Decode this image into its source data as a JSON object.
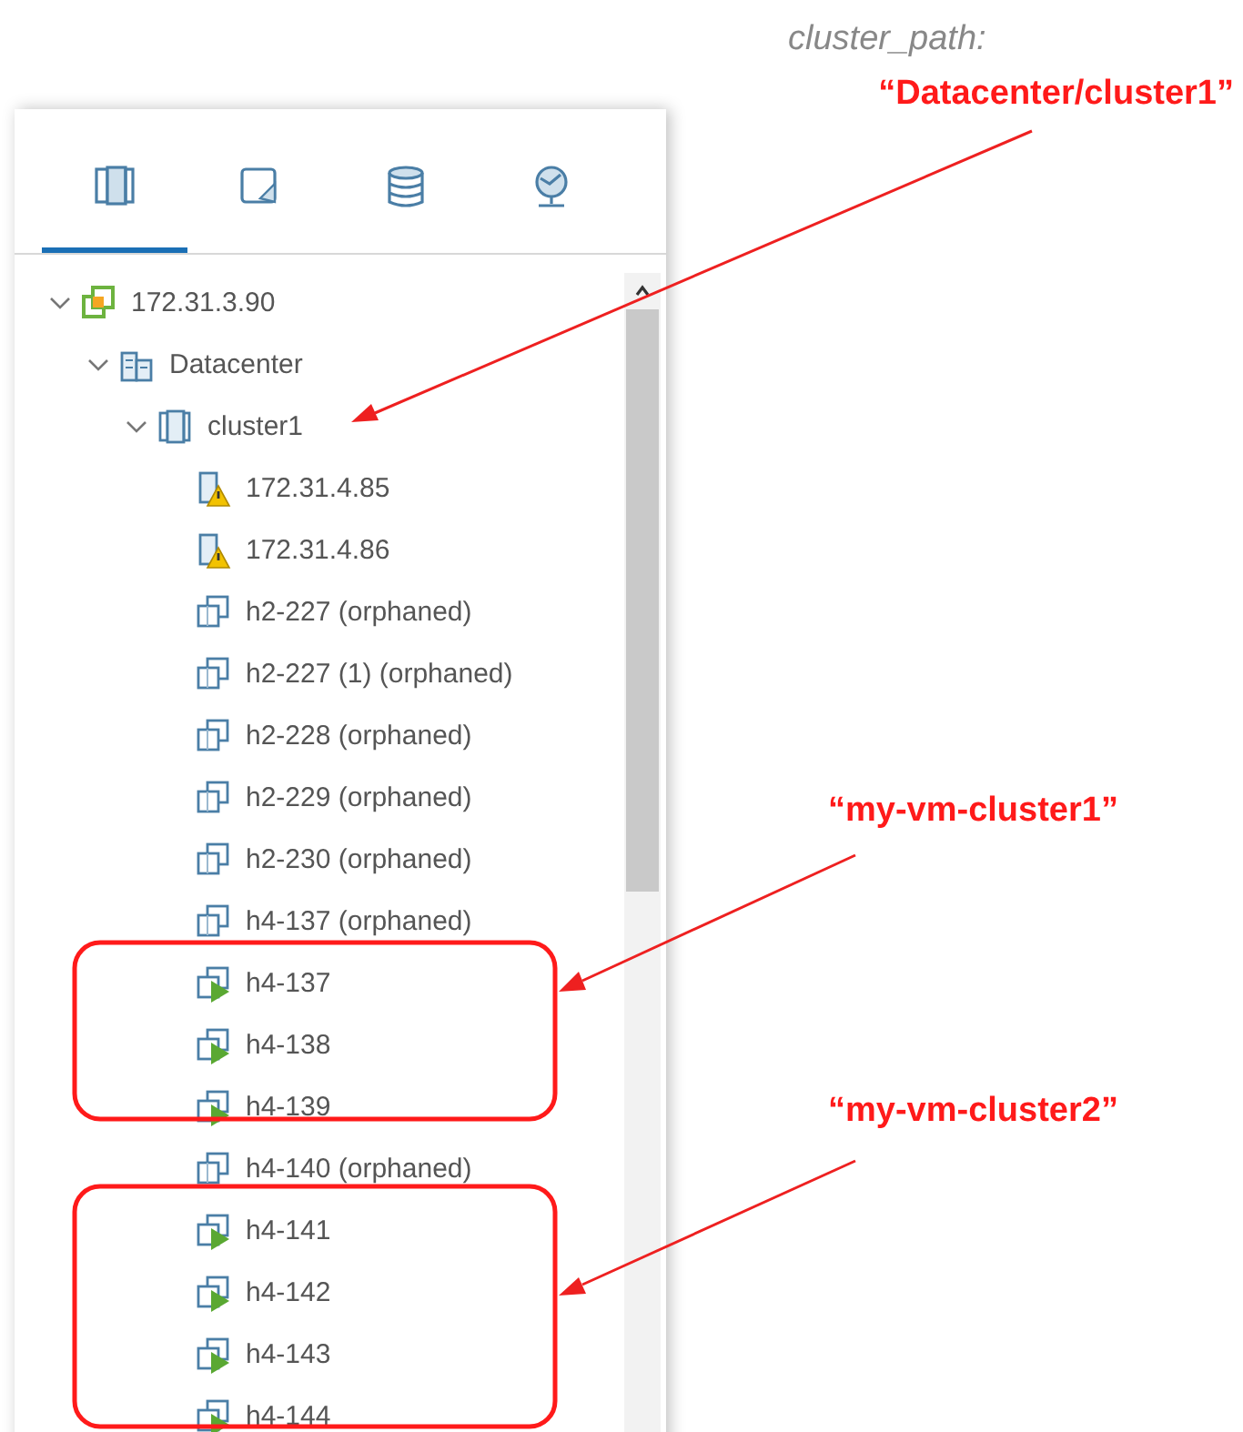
{
  "tabs": [
    {
      "kind": "hosts",
      "selected": true
    },
    {
      "kind": "vms",
      "selected": false
    },
    {
      "kind": "storage",
      "selected": false
    },
    {
      "kind": "network",
      "selected": false
    }
  ],
  "tree": [
    {
      "kind": "vcenter",
      "label": "172.31.3.90",
      "expanded": true,
      "children": [
        {
          "kind": "datacenter",
          "label": "Datacenter",
          "expanded": true,
          "children": [
            {
              "kind": "cluster",
              "label": "cluster1",
              "expanded": true,
              "children": [
                {
                  "kind": "host-warning",
                  "label": "172.31.4.85"
                },
                {
                  "kind": "host-warning",
                  "label": "172.31.4.86"
                },
                {
                  "kind": "vm-orphaned",
                  "label": "h2-227 (orphaned)"
                },
                {
                  "kind": "vm-orphaned",
                  "label": "h2-227 (1) (orphaned)"
                },
                {
                  "kind": "vm-orphaned",
                  "label": "h2-228 (orphaned)"
                },
                {
                  "kind": "vm-orphaned",
                  "label": "h2-229 (orphaned)"
                },
                {
                  "kind": "vm-orphaned",
                  "label": "h2-230 (orphaned)"
                },
                {
                  "kind": "vm-orphaned",
                  "label": "h4-137 (orphaned)"
                },
                {
                  "kind": "vm-on",
                  "label": "h4-137"
                },
                {
                  "kind": "vm-on",
                  "label": "h4-138"
                },
                {
                  "kind": "vm-on",
                  "label": "h4-139"
                },
                {
                  "kind": "vm-orphaned",
                  "label": "h4-140 (orphaned)"
                },
                {
                  "kind": "vm-on",
                  "label": "h4-141"
                },
                {
                  "kind": "vm-on",
                  "label": "h4-142"
                },
                {
                  "kind": "vm-on",
                  "label": "h4-143"
                },
                {
                  "kind": "vm-on",
                  "label": "h4-144"
                }
              ]
            }
          ]
        }
      ]
    }
  ],
  "annotations": [
    {
      "kind": "key",
      "text": "cluster_path:"
    },
    {
      "kind": "value",
      "text": "“Datacenter/cluster1”"
    },
    {
      "kind": "value",
      "text": "“my-vm-cluster1”"
    },
    {
      "kind": "value",
      "text": "“my-vm-cluster2”"
    }
  ]
}
